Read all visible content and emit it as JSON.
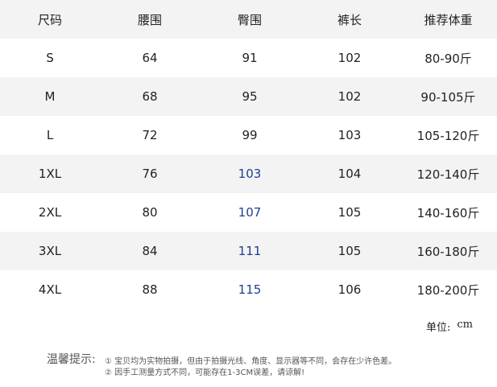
{
  "table": {
    "headers": [
      "尺码",
      "腰围",
      "臀围",
      "裤长",
      "推荐体重"
    ],
    "rows": [
      [
        "S",
        "64",
        "91",
        "102",
        "80-90斤"
      ],
      [
        "M",
        "68",
        "95",
        "102",
        "90-105斤"
      ],
      [
        "L",
        "72",
        "99",
        "103",
        "105-120斤"
      ],
      [
        "1XL",
        "76",
        "103",
        "104",
        "120-140斤"
      ],
      [
        "2XL",
        "80",
        "107",
        "105",
        "140-160斤"
      ],
      [
        "3XL",
        "84",
        "111",
        "105",
        "160-180斤"
      ],
      [
        "4XL",
        "88",
        "115",
        "106",
        "180-200斤"
      ]
    ],
    "shaded_row_color": "#f3f3f3",
    "highlight_text_color": "#1f3f8f"
  },
  "unit": {
    "label": "单位:",
    "value": "cm"
  },
  "tips": {
    "title": "温馨提示:",
    "lines": [
      "① 宝贝均为实物拍摄，但由于拍摄光线、角度、显示器等不同，会存在少许色差。",
      "② 因手工测量方式不同，可能存在1-3CM误差，请谅解!"
    ]
  }
}
